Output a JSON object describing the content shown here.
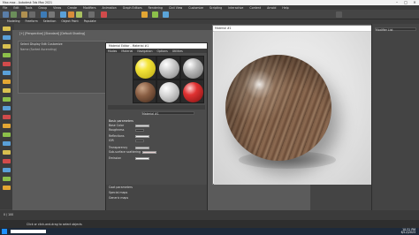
{
  "app": {
    "title": "Max.max - Autodesk 3ds Max 2021",
    "menus": [
      "File",
      "Edit",
      "Tools",
      "Group",
      "Views",
      "Create",
      "Modifiers",
      "Animation",
      "Graph Editors",
      "Rendering",
      "Civil View",
      "Customize",
      "Scripting",
      "Interactive",
      "Content",
      "Arnold",
      "Help"
    ]
  },
  "ribbon": {
    "tabs": [
      "Modeling",
      "Freeform",
      "Selection",
      "Object Paint",
      "Populate"
    ]
  },
  "scene_explorer": {
    "tab_label": "Select Display Edit Customize",
    "filter_label": "Select Set",
    "sort": "Name (Sorted Ascending)"
  },
  "viewport": {
    "label": "[+] [Perspective] [Standard] [Default Shading]"
  },
  "material_editor": {
    "title": "Material Editor - Material #1",
    "menu": [
      "Modes",
      "Material",
      "Navigation",
      "Options",
      "Utilities"
    ],
    "material_name": "Material #1",
    "material_type": "Physical Material",
    "sections": {
      "basic": "Basic parameters",
      "coat": "Coat parameters",
      "special": "Special maps",
      "generic": "Generic maps"
    },
    "rows": {
      "diffuse": "Base Color",
      "roughness": "Roughness",
      "reflections": "Reflections",
      "ior": "IOR",
      "transparency": "Transparency",
      "sss": "Sub-surface scattering",
      "emission": "Emission"
    }
  },
  "render_window": {
    "title": "Material #1"
  },
  "command_panel": {
    "label": "Modifier List"
  },
  "timeline": {
    "frame": "0 / 100"
  },
  "status": {
    "text": "Click or click-and-drag to select objects",
    "time": "10:31 PM",
    "date": "6/12/2023"
  }
}
